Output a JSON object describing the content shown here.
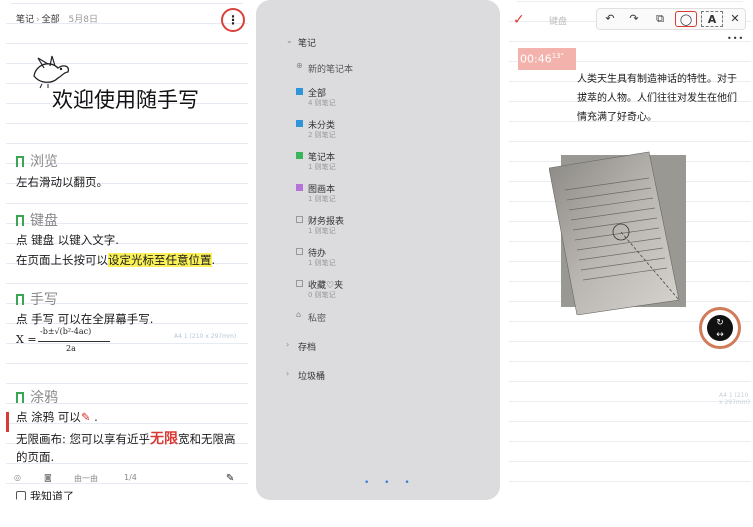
{
  "panel1": {
    "breadcrumb_notes": "笔记",
    "breadcrumb_sep": "›",
    "breadcrumb_all": "全部",
    "date": "5月8日",
    "more_icon": "⋮",
    "welcome_title": "欢迎使用随手写",
    "sections": [
      {
        "title": "浏览",
        "lines": [
          "左右滑动以翻页。"
        ]
      },
      {
        "title": "键盘",
        "line1": "点 键盘 以键入文字.",
        "line2_prefix": "在页面上长按可以",
        "line2_highlight": "设定光标至任意位置",
        "line2_suffix": "."
      },
      {
        "title": "手写",
        "line1": "点 手写 可以在全屏幕手写."
      },
      {
        "title": "涂鸦",
        "line1_prefix": "点 涂鸦 可以",
        "line1_suffix": " .",
        "line2_prefix": "无限画布: 您可以享有近乎",
        "line2_red": "无限",
        "line2_suffix": "宽和无限高",
        "line3": "的页面."
      }
    ],
    "formula": {
      "var": "X =",
      "numerator": "-b±√(b²-4ac)",
      "denominator": "2a"
    },
    "page_hint": "A4 1 (210 x 297mm)",
    "bottom": {
      "page_label": "由一由",
      "page_count": "1/4"
    },
    "got_it": "我知道了"
  },
  "panel2": {
    "header": "笔记",
    "new_notebook": "新的笔记本",
    "items": [
      {
        "label": "全部",
        "count": "4 则笔记",
        "color": "#2f95d8"
      },
      {
        "label": "未分类",
        "count": "2 则笔记",
        "color": "#2f95d8"
      },
      {
        "label": "笔记本",
        "count": "1 则笔记",
        "color": "#3bb55a"
      },
      {
        "label": "图画本",
        "count": "1 则笔记",
        "color": "#b873d8"
      },
      {
        "label": "财务报表",
        "count": "1 则笔记",
        "color": ""
      },
      {
        "label": "待办",
        "count": "1 则笔记",
        "color": ""
      },
      {
        "label": "收藏♡夹",
        "count": "0 则笔记",
        "color": ""
      }
    ],
    "private": "私密",
    "archive": "存档",
    "trash": "垃圾桶",
    "pager_dots": "• • •"
  },
  "panel3": {
    "check_icon": "✓",
    "keyboard_label": "键盘",
    "toolbar": {
      "undo": "↶",
      "redo": "↷",
      "copy": "⧉",
      "lasso": "◯",
      "text": "A",
      "close": "✕"
    },
    "more": "•••",
    "recording": "00:46",
    "recording_sup": "13\"",
    "text_line1": "人类天生具有制造神话的特性。对于",
    "text_line2": "拔萃的人物。人们往往对发生在他们",
    "text_line3": "情充满了好奇心。",
    "page_hint": "A4 1 (210 x 297mm)",
    "rotate_icon": "↻",
    "swap_icon": "↔"
  }
}
